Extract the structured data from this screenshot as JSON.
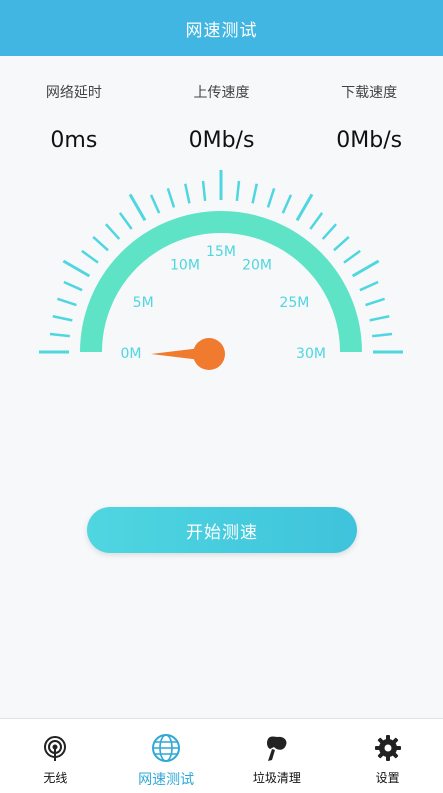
{
  "header": {
    "title": "网速测试"
  },
  "stats": [
    {
      "label": "网络延时",
      "value": "0ms"
    },
    {
      "label": "上传速度",
      "value": "0Mb/s"
    },
    {
      "label": "下载速度",
      "value": "0Mb/s"
    }
  ],
  "gauge": {
    "scale_labels": [
      "0M",
      "5M",
      "10M",
      "15M",
      "20M",
      "25M",
      "30M"
    ],
    "current_speed": 0,
    "max_speed": 30,
    "arc_color": "#5fe3c7",
    "tick_color": "#4fd6e0",
    "needle_color": "#f07a2e"
  },
  "start_button": {
    "label": "开始测速"
  },
  "nav": {
    "items": [
      {
        "label": "无线",
        "icon": "wifi-icon"
      },
      {
        "label": "网速测试",
        "icon": "globe-icon",
        "active": true
      },
      {
        "label": "垃圾清理",
        "icon": "broom-icon"
      },
      {
        "label": "设置",
        "icon": "gear-icon"
      }
    ]
  }
}
